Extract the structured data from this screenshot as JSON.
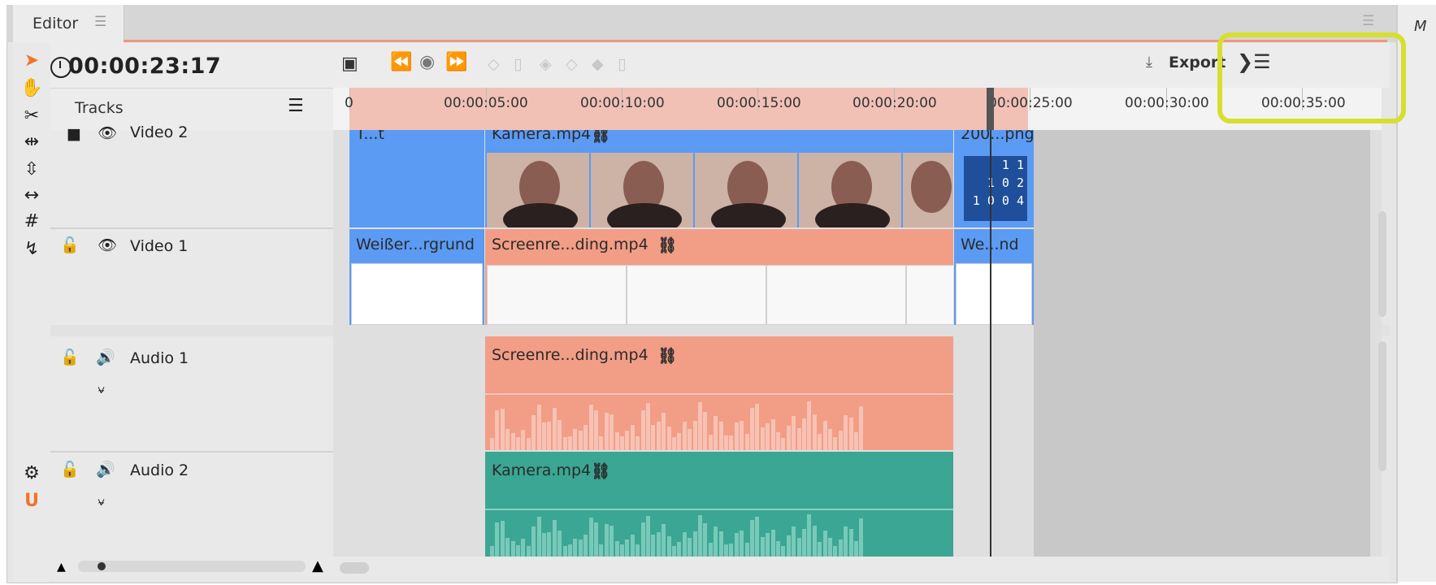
{
  "window": {
    "tab_label": "Editor",
    "right_panel_label": "M"
  },
  "timecode": "00:00:23:17",
  "tracks_header": "Tracks",
  "toolbar": {
    "export_label": "Export"
  },
  "ruler": {
    "labels": [
      "0",
      "00:00:05:00",
      "00:00:10:00",
      "00:00:15:00",
      "00:00:20:00",
      "00:00:25:00",
      "00:00:30:00",
      "00:00:35:00"
    ]
  },
  "tracks": [
    {
      "name": "Video 2",
      "type": "video"
    },
    {
      "name": "Video 1",
      "type": "video"
    },
    {
      "name": "Audio 1",
      "type": "audio"
    },
    {
      "name": "Audio 2",
      "type": "audio"
    }
  ],
  "clips": {
    "v2_a": "T...t",
    "v2_b": "Kamera.mp4",
    "v2_c": "200...png",
    "v1_a": "Weißer...rgrund",
    "v1_b": "Screenre...ding.mp4",
    "v1_c": "We...nd",
    "a1": "Screenre...ding.mp4",
    "a2": "Kamera.mp4"
  },
  "image_text": {
    "line1": "1 1",
    "line2": "1 0 2",
    "line3": "1 0 0 4"
  },
  "colors": {
    "accent": "#f29578",
    "video_blue": "#5b9bf4",
    "audio_salmon": "#f29d86",
    "audio_teal": "#3aa693",
    "highlight": "#d6df30"
  }
}
